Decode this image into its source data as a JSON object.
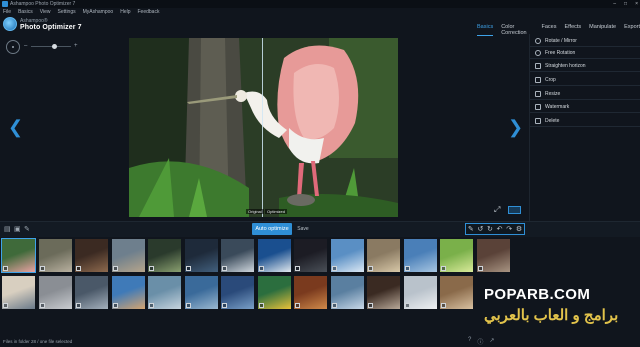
{
  "window": {
    "title": "Ashampoo Photo Optimizer 7",
    "controls": [
      "–",
      "□",
      "×"
    ]
  },
  "menu": [
    "File",
    "Basics",
    "View",
    "Settings",
    "MyAshampoo",
    "Help",
    "Feedback"
  ],
  "logo": {
    "brand": "Ashampoo®",
    "product": "Photo Optimizer 7"
  },
  "tabs": [
    {
      "label": "Basics",
      "active": true
    },
    {
      "label": "Color Correction",
      "active": false
    },
    {
      "label": "Faces",
      "active": false
    },
    {
      "label": "Effects",
      "active": false
    },
    {
      "label": "Manipulate",
      "active": false
    },
    {
      "label": "Export",
      "active": false
    }
  ],
  "zoom": {
    "minus": "–",
    "plus": "+"
  },
  "photo": {
    "label_original": "Original",
    "label_optimized": "Optimized"
  },
  "panel_items": [
    {
      "label": "Rotate / Mirror",
      "icon": "rotate-icon"
    },
    {
      "label": "Free Rotation",
      "icon": "free-rotation-icon"
    },
    {
      "label": "Straighten horizon",
      "icon": "horizon-icon"
    },
    {
      "label": "Crop",
      "icon": "crop-icon"
    },
    {
      "label": "Resize",
      "icon": "resize-icon"
    },
    {
      "label": "Watermark",
      "icon": "watermark-icon"
    },
    {
      "label": "Delete",
      "icon": "delete-icon"
    }
  ],
  "toolbar": {
    "auto_optimize": "Auto optimize",
    "save": "Save"
  },
  "thumbnails": [
    {
      "colors": [
        "#3f6a3a",
        "#e9a3a3"
      ]
    },
    {
      "colors": [
        "#6b6b5a",
        "#b9b1a0"
      ]
    },
    {
      "colors": [
        "#3b2a22",
        "#8e6a4e"
      ]
    },
    {
      "colors": [
        "#6e7f8d",
        "#b6a58b"
      ]
    },
    {
      "colors": [
        "#2a3a2c",
        "#8aa070"
      ]
    },
    {
      "colors": [
        "#1e2a3a",
        "#42607e"
      ]
    },
    {
      "colors": [
        "#3a4a5a",
        "#cfd7de"
      ]
    },
    {
      "colors": [
        "#1a4f8f",
        "#e0e8ee"
      ]
    },
    {
      "colors": [
        "#1c1c24",
        "#4a5058"
      ]
    },
    {
      "colors": [
        "#5a8fc4",
        "#dbe8f4"
      ]
    },
    {
      "colors": [
        "#8a7a62",
        "#d8c8a8"
      ]
    },
    {
      "colors": [
        "#4a7fb8",
        "#a7c6e2"
      ]
    },
    {
      "colors": [
        "#7ab04a",
        "#d9ea9a"
      ]
    },
    {
      "colors": [
        "#5a4238",
        "#a89482"
      ]
    },
    {
      "colors": [
        "#d8cfc0",
        "#6a7a8a"
      ]
    },
    {
      "colors": [
        "#8a8e94",
        "#c9ccd0"
      ]
    },
    {
      "colors": [
        "#4a5868",
        "#a4b0bc"
      ]
    },
    {
      "colors": [
        "#3f7ab8",
        "#d4a470"
      ]
    },
    {
      "colors": [
        "#6a8fa8",
        "#c6d4de"
      ]
    },
    {
      "colors": [
        "#3a6a9a",
        "#9ab8d0"
      ]
    },
    {
      "colors": [
        "#2a4a7a",
        "#7aa0c8"
      ]
    },
    {
      "colors": [
        "#2b6e3e",
        "#e8c23a"
      ]
    },
    {
      "colors": [
        "#7a3a1e",
        "#d08a4a"
      ]
    },
    {
      "colors": [
        "#5a7fa0",
        "#c8d8e8"
      ]
    },
    {
      "colors": [
        "#3a2a22",
        "#b8a898"
      ]
    },
    {
      "colors": [
        "#b9c2cb",
        "#eef0f2"
      ]
    },
    {
      "colors": [
        "#8a6a4a",
        "#d8c0a0"
      ]
    }
  ],
  "status": "Files in folder 28 / one file selected",
  "watermark": {
    "english": "POPARB.COM",
    "arabic": "برامج و العاب بالعربي"
  }
}
